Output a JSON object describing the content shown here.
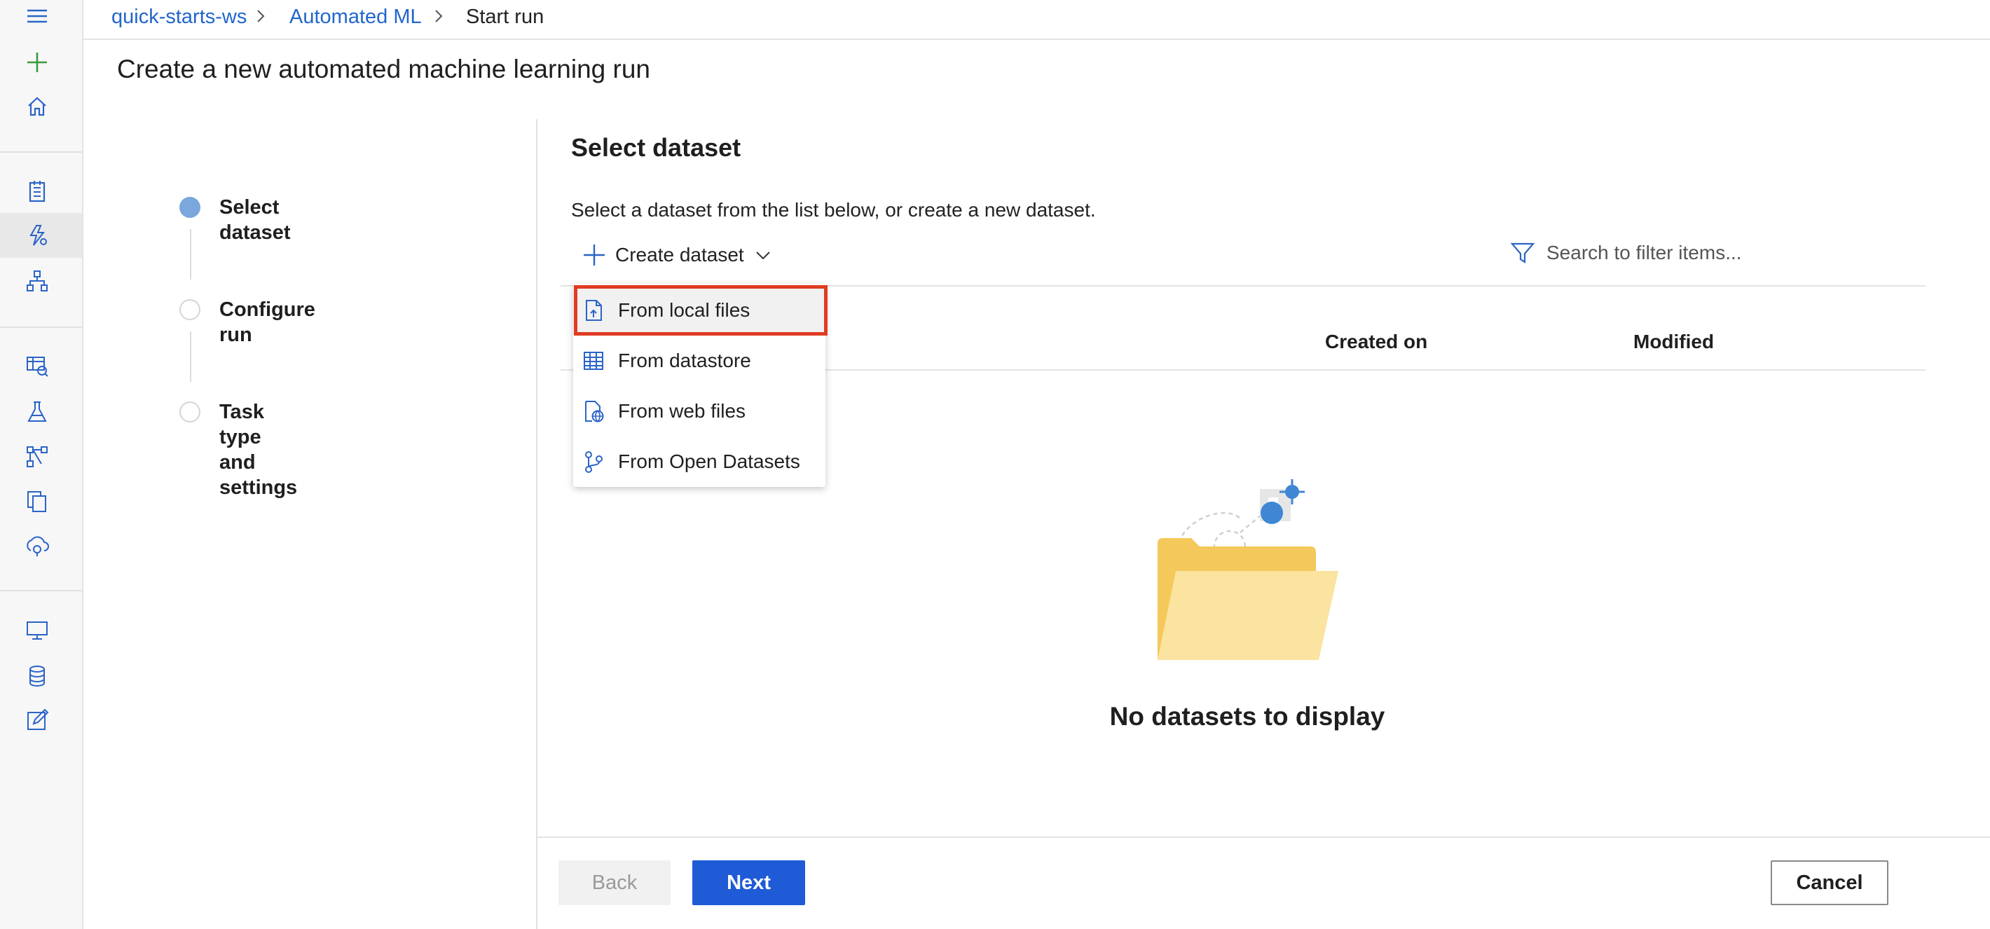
{
  "breadcrumb": {
    "items": [
      "quick-starts-ws",
      "Automated ML",
      "Start run"
    ]
  },
  "page": {
    "title": "Create a new automated machine learning run"
  },
  "steps": [
    {
      "label": "Select dataset",
      "state": "active"
    },
    {
      "label": "Configure run",
      "state": "pending"
    },
    {
      "label": "Task type and settings",
      "state": "pending"
    }
  ],
  "section": {
    "title": "Select dataset",
    "description": "Select a dataset from the list below, or create a new dataset."
  },
  "toolbar": {
    "create_label": "Create dataset",
    "search_placeholder": "Search to filter items..."
  },
  "menu": {
    "items": [
      "From local files",
      "From datastore",
      "From web files",
      "From Open Datasets"
    ]
  },
  "table": {
    "columns": [
      "Created on",
      "Modified"
    ]
  },
  "empty": {
    "text": "No datasets to display"
  },
  "footer": {
    "back_label": "Back",
    "next_label": "Next",
    "cancel_label": "Cancel"
  },
  "colors": {
    "accent": "#2266cc",
    "primary_button": "#1f5bd6",
    "highlight_border": "#e03c22",
    "step_active": "#7aa7dc",
    "folder": "#f4c85a"
  },
  "icons": {
    "rail": [
      "hamburger-icon",
      "plus-icon",
      "home-icon",
      "notebook-icon",
      "automl-icon",
      "designer-icon",
      "datasets-icon",
      "experiments-icon",
      "pipelines-icon",
      "models-icon",
      "endpoints-icon",
      "compute-icon",
      "datastores-icon",
      "labeling-icon"
    ]
  }
}
